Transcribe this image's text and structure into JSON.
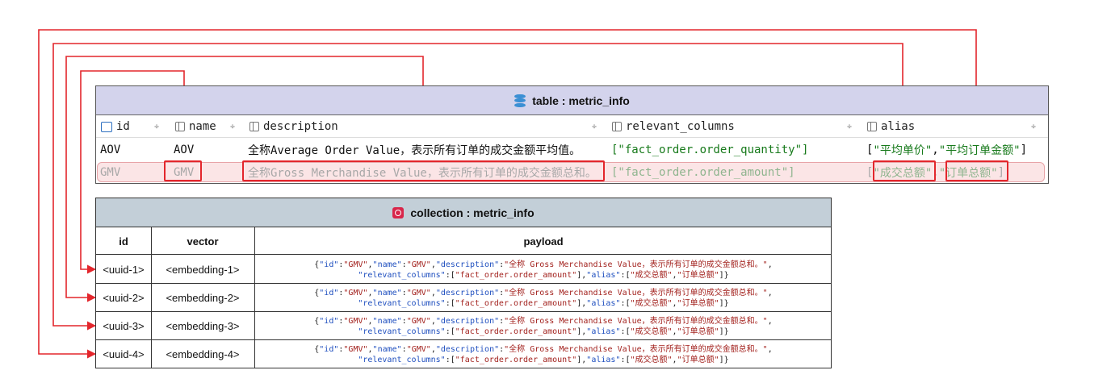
{
  "table": {
    "title": "table : metric_info",
    "columns": [
      {
        "label": "id",
        "sort": "÷"
      },
      {
        "label": "name",
        "sort": "÷"
      },
      {
        "label": "description",
        "sort": "÷"
      },
      {
        "label": "relevant_columns",
        "sort": "÷"
      },
      {
        "label": "alias",
        "sort": "÷"
      }
    ],
    "rows": [
      {
        "id": "AOV",
        "name": "AOV",
        "description": "全称Average Order Value，表示所有订单的成交金额平均值。",
        "relevant_columns": "[\"fact_order.order_quantity\"]",
        "alias_open": "[",
        "alias_a": "\"平均单价\"",
        "alias_sep": ", ",
        "alias_b": "\"平均订单金额\"",
        "alias_close": "]"
      },
      {
        "id": "GMV",
        "name": "GMV",
        "description": "全称Gross Merchandise Value，表示所有订单的成交金额总和。",
        "relevant_columns": "[\"fact_order.order_amount\"]",
        "alias_open": "[",
        "alias_a": "\"成交总额\"",
        "alias_sep": ", ",
        "alias_b": "\"订单总额\"",
        "alias_close": "]"
      }
    ]
  },
  "collection": {
    "title": "collection : metric_info",
    "headers": {
      "id": "id",
      "vector": "vector",
      "payload": "payload"
    },
    "payload": {
      "p1": "{",
      "k_id": "\"id\"",
      "c1": ":",
      "v_id": "\"GMV\"",
      "s1": ",",
      "k_name": "\"name\"",
      "c2": ":",
      "v_name": "\"GMV\"",
      "s2": ",",
      "k_desc": "\"description\"",
      "c3": ":",
      "v_desc": "\"全称 Gross Merchandise Value，表示所有订单的成交金额总和。\"",
      "s3": ",",
      "k_rel": "\"relevant_columns\"",
      "c4": ":[",
      "v_rel": "\"fact_order.order_amount\"",
      "s4": "],",
      "k_alias": "\"alias\"",
      "c5": ":[",
      "v_alias_a": "\"成交总额\"",
      "s5": ",",
      "v_alias_b": "\"订单总额\"",
      "p2": "]}"
    },
    "rows": [
      {
        "id": "<uuid-1>",
        "vector": "<embedding-1>"
      },
      {
        "id": "<uuid-2>",
        "vector": "<embedding-2>"
      },
      {
        "id": "<uuid-3>",
        "vector": "<embedding-3>"
      },
      {
        "id": "<uuid-4>",
        "vector": "<embedding-4>"
      }
    ]
  },
  "colors": {
    "connector": "#e3262c",
    "table_title_bg": "#d3d3ec",
    "collection_title_bg": "#c3cfd8",
    "highlight_row_bg": "#fbe5e6",
    "payload_key": "#1f4fbf",
    "payload_value": "#a3231f",
    "string_green": "#177a1b"
  },
  "icons": {
    "table": "database-icon",
    "collection": "milvus-collection-icon",
    "id_column": "key-column-icon",
    "column": "column-icon"
  }
}
